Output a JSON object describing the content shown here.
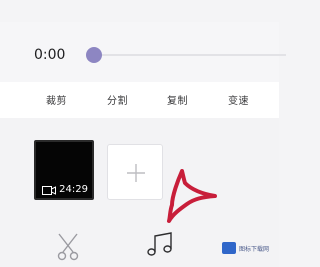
{
  "player": {
    "current_time": "0:00",
    "progress": 0
  },
  "toolbar": {
    "items": [
      {
        "label": "裁剪"
      },
      {
        "label": "分割"
      },
      {
        "label": "复制"
      },
      {
        "label": "变速"
      }
    ]
  },
  "clips": {
    "items": [
      {
        "duration": "24:29",
        "icon": "video-camera-icon"
      }
    ],
    "add_icon": "plus-icon"
  },
  "bottom_tools": {
    "items": [
      {
        "icon": "scissors-icon"
      },
      {
        "icon": "music-note-icon"
      }
    ]
  },
  "annotation": {
    "icon": "red-arrow-pointer",
    "color": "#c81e3a"
  },
  "watermark": {
    "text": "图标下载网"
  },
  "colors": {
    "accent": "#8d86c2",
    "background": "#f4f4f6"
  }
}
